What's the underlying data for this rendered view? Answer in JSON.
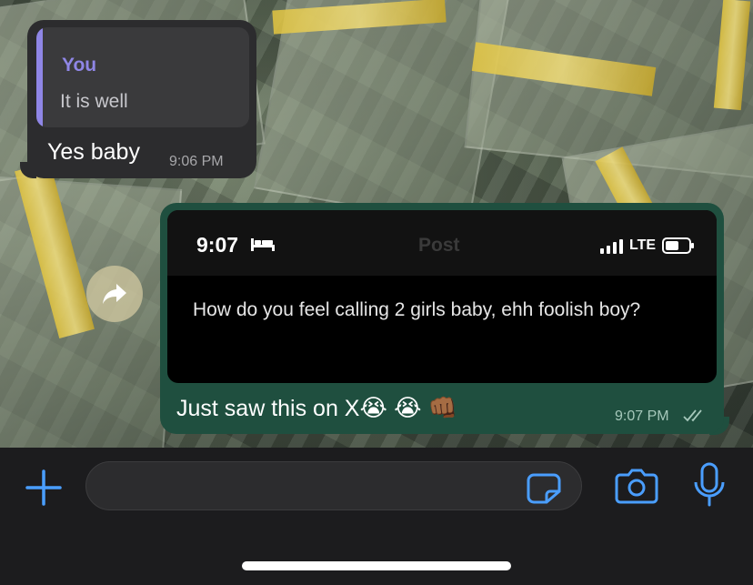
{
  "chat": {
    "received": {
      "quote_author": "You",
      "quote_text": "It is well",
      "text": "Yes baby",
      "time": "9:06 PM"
    },
    "sent": {
      "screenshot": {
        "clock": "9:07",
        "title": "Post",
        "network": "LTE",
        "tweet_text": "How do you feel calling 2 girls baby, ehh foolish boy?"
      },
      "text": "Just saw this on X",
      "emojis": "😭 😭 👊🏾",
      "time": "9:07 PM"
    }
  },
  "input": {
    "placeholder": ""
  },
  "icons": {
    "attach": "plus-icon",
    "forward": "forward-arrow-icon",
    "sticker": "sticker-icon",
    "camera": "camera-icon",
    "mic": "microphone-icon"
  },
  "colors": {
    "accent": "#4a9eff",
    "sent_bubble": "#1f4f3f",
    "received_bubble": "#2c2c2e",
    "quote_accent": "#8f86e6"
  }
}
